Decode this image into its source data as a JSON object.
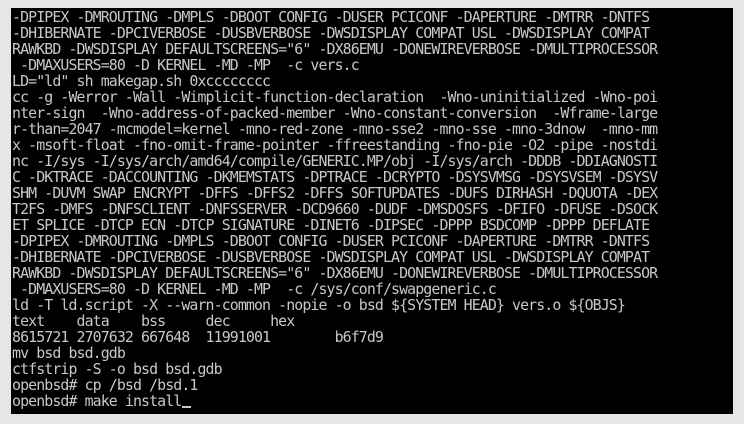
{
  "console": {
    "lines": [
      "-DPIPEX -DMROUTING -DMPLS -DBOOT_CONFIG -DUSER_PCICONF -DAPERTURE -DMTRR -DNTFS",
      "-DHIBERNATE -DPCIVERBOSE -DUSBVERBOSE -DWSDISPLAY_COMPAT_USL -DWSDISPLAY_COMPAT_",
      "RAWKBD -DWSDISPLAY_DEFAULTSCREENS=\"6\" -DX86EMU -DONEWIREVERBOSE -DMULTIPROCESSOR",
      " -DMAXUSERS=80 -D_KERNEL -MD -MP  -c vers.c",
      "LD=\"ld\" sh makegap.sh 0xcccccccc",
      "cc -g -Werror -Wall -Wimplicit-function-declaration  -Wno-uninitialized -Wno-poi",
      "nter-sign  -Wno-address-of-packed-member -Wno-constant-conversion  -Wframe-large",
      "r-than=2047 -mcmodel=kernel -mno-red-zone -mno-sse2 -mno-sse -mno-3dnow  -mno-mm",
      "x -msoft-float -fno-omit-frame-pointer -ffreestanding -fno-pie -O2 -pipe -nostdi",
      "nc -I/sys -I/sys/arch/amd64/compile/GENERIC.MP/obj -I/sys/arch -DDDB -DDIAGNOSTI",
      "C -DKTRACE -DACCOUNTING -DKMEMSTATS -DPTRACE -DCRYPTO -DSYSVMSG -DSYSVSEM -DSYSV",
      "SHM -DUVM_SWAP_ENCRYPT -DFFS -DFFS2 -DFFS_SOFTUPDATES -DUFS_DIRHASH -DQUOTA -DEX",
      "T2FS -DMFS -DNFSCLIENT -DNFSSERVER -DCD9660 -DUDF -DMSDOSFS -DFIFO -DFUSE -DSOCK",
      "ET_SPLICE -DTCP_ECN -DTCP_SIGNATURE -DINET6 -DIPSEC -DPPP_BSDCOMP -DPPP_DEFLATE",
      "-DPIPEX -DMROUTING -DMPLS -DBOOT_CONFIG -DUSER_PCICONF -DAPERTURE -DMTRR -DNTFS",
      "-DHIBERNATE -DPCIVERBOSE -DUSBVERBOSE -DWSDISPLAY_COMPAT_USL -DWSDISPLAY_COMPAT_",
      "RAWKBD -DWSDISPLAY_DEFAULTSCREENS=\"6\" -DX86EMU -DONEWIREVERBOSE -DMULTIPROCESSOR",
      " -DMAXUSERS=80 -D_KERNEL -MD -MP  -c /sys/conf/swapgeneric.c",
      "ld -T ld.script -X --warn-common -nopie -o bsd ${SYSTEM_HEAD} vers.o ${OBJS}",
      "text    data    bss     dec     hex",
      "8615721 2707632 667648  11991001        b6f7d9",
      "mv bsd bsd.gdb",
      "ctfstrip -S -o bsd bsd.gdb",
      "openbsd# cp /bsd /bsd.1"
    ],
    "prompt_line": "openbsd# make install"
  },
  "colors": {
    "terminal_background": "#000000",
    "terminal_text": "#c8c8c8",
    "window_frame": "#e6e6e6"
  }
}
